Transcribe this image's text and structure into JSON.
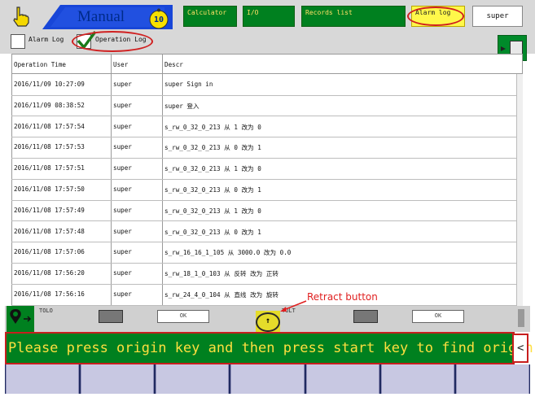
{
  "header": {
    "mode_label": "Manual",
    "badge_number": "10",
    "buttons": {
      "calculator": "Calculator",
      "io": "I/O",
      "records_list": "Records list",
      "alarm_log": "Alarm log",
      "user": "super"
    }
  },
  "filters": {
    "alarm_log": {
      "label": "Alarm Log",
      "checked": false
    },
    "operation_log": {
      "label": "Operation Log",
      "checked": true
    }
  },
  "table": {
    "columns": [
      "Operation Time",
      "User",
      "Descr"
    ],
    "rows": [
      {
        "time": "2016/11/09 10:27:09",
        "user": "super",
        "descr": "super Sign in"
      },
      {
        "time": "2016/11/09 08:38:52",
        "user": "super",
        "descr": "super 登入"
      },
      {
        "time": "2016/11/08 17:57:54",
        "user": "super",
        "descr": "s_rw_0_32_0_213 从 1 改为 0"
      },
      {
        "time": "2016/11/08 17:57:53",
        "user": "super",
        "descr": "s_rw_0_32_0_213 从 0 改为 1"
      },
      {
        "time": "2016/11/08 17:57:51",
        "user": "super",
        "descr": "s_rw_0_32_0_213 从 1 改为 0"
      },
      {
        "time": "2016/11/08 17:57:50",
        "user": "super",
        "descr": "s_rw_0_32_0_213 从 0 改为 1"
      },
      {
        "time": "2016/11/08 17:57:49",
        "user": "super",
        "descr": "s_rw_0_32_0_213 从 1 改为 0"
      },
      {
        "time": "2016/11/08 17:57:48",
        "user": "super",
        "descr": "s_rw_0_32_0_213 从 0 改为 1"
      },
      {
        "time": "2016/11/08 17:57:06",
        "user": "super",
        "descr": "s_rw_16_16_1_105 从 3000.0 改为 0.0"
      },
      {
        "time": "2016/11/08 17:56:20",
        "user": "super",
        "descr": "s_rw_18_1_0_103 从 反转 改为 正转"
      },
      {
        "time": "2016/11/08 17:56:16",
        "user": "super",
        "descr": "s_rw_24_4_0_104 从 直线 改为 旋转"
      }
    ]
  },
  "lower_band": {
    "left_text": "TOLO",
    "box1_text": "OK",
    "mid_text": "TOLT",
    "box2_text": "OK",
    "retract_label": "Retract button",
    "up_arrow": "↑"
  },
  "message": {
    "text": "Please press origin key and then press start key to find origin",
    "side_button": "<"
  },
  "colors": {
    "green": "#00801f",
    "yellow_text": "#ffdf3f",
    "highlight_red": "#d02020",
    "mode_blue": "#1846d8"
  },
  "icons": [
    "hand-pointer-icon",
    "location-pin-icon",
    "up-arrow-icon",
    "memory-chip-icon",
    "check-icon"
  ]
}
